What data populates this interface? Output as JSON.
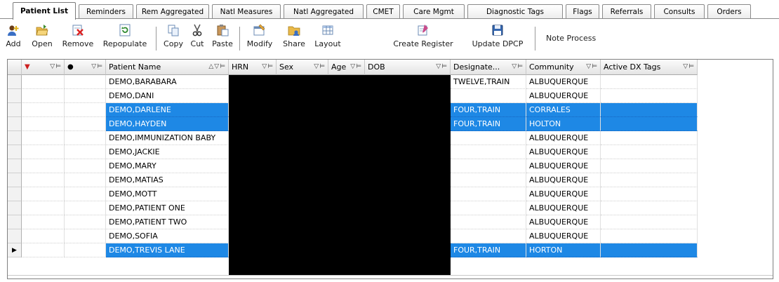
{
  "tabs": [
    {
      "label": "Patient List",
      "active": true
    },
    {
      "label": "Reminders"
    },
    {
      "label": "Rem Aggregated"
    },
    {
      "label": "Natl Measures"
    },
    {
      "label": "Natl Aggregated"
    },
    {
      "label": "CMET"
    },
    {
      "label": "Care Mgmt"
    },
    {
      "label": "Diagnostic Tags"
    },
    {
      "label": "Flags"
    },
    {
      "label": "Referrals"
    },
    {
      "label": "Consults"
    },
    {
      "label": "Orders"
    }
  ],
  "toolbar": {
    "add": "Add",
    "open": "Open",
    "remove": "Remove",
    "repopulate": "Repopulate",
    "copy": "Copy",
    "cut": "Cut",
    "paste": "Paste",
    "modify": "Modify",
    "share": "Share",
    "layout": "Layout",
    "create_register": "Create Register",
    "update_dpcp": "Update DPCP",
    "note_process": "Note Process"
  },
  "grid": {
    "headers": {
      "patient_name": "Patient Name",
      "hrn": "HRN",
      "sex": "Sex",
      "age": "Age",
      "dob": "DOB",
      "designated": "Designate...",
      "community": "Community",
      "active_dx_tags": "Active DX Tags"
    },
    "rows": [
      {
        "name": "DEMO,BARABARA",
        "designated": "TWELVE,TRAIN",
        "community": "ALBUQUERQUE",
        "selected": false
      },
      {
        "name": "DEMO,DANI",
        "designated": "",
        "community": "ALBUQUERQUE",
        "selected": false
      },
      {
        "name": "DEMO,DARLENE",
        "designated": "FOUR,TRAIN",
        "community": "CORRALES",
        "selected": true
      },
      {
        "name": "DEMO,HAYDEN",
        "designated": "FOUR,TRAIN",
        "community": "HOLTON",
        "selected": true
      },
      {
        "name": "DEMO,IMMUNIZATION BABY",
        "designated": "",
        "community": "ALBUQUERQUE",
        "selected": false
      },
      {
        "name": "DEMO,JACKIE",
        "designated": "",
        "community": "ALBUQUERQUE",
        "selected": false
      },
      {
        "name": "DEMO,MARY",
        "designated": "",
        "community": "ALBUQUERQUE",
        "selected": false
      },
      {
        "name": "DEMO,MATIAS",
        "designated": "",
        "community": "ALBUQUERQUE",
        "selected": false
      },
      {
        "name": "DEMO,MOTT",
        "designated": "",
        "community": "ALBUQUERQUE",
        "selected": false
      },
      {
        "name": "DEMO,PATIENT ONE",
        "designated": "",
        "community": "ALBUQUERQUE",
        "selected": false
      },
      {
        "name": "DEMO,PATIENT TWO",
        "designated": "",
        "community": "ALBUQUERQUE",
        "selected": false
      },
      {
        "name": "DEMO,SOFIA",
        "designated": "",
        "community": "ALBUQUERQUE",
        "selected": false
      },
      {
        "name": "DEMO,TREVIS LANE",
        "designated": "FOUR,TRAIN",
        "community": "HORTON",
        "selected": true,
        "current": true
      }
    ]
  },
  "colors": {
    "selection": "#1e88e5",
    "flag_red": "#cc1f1f"
  }
}
